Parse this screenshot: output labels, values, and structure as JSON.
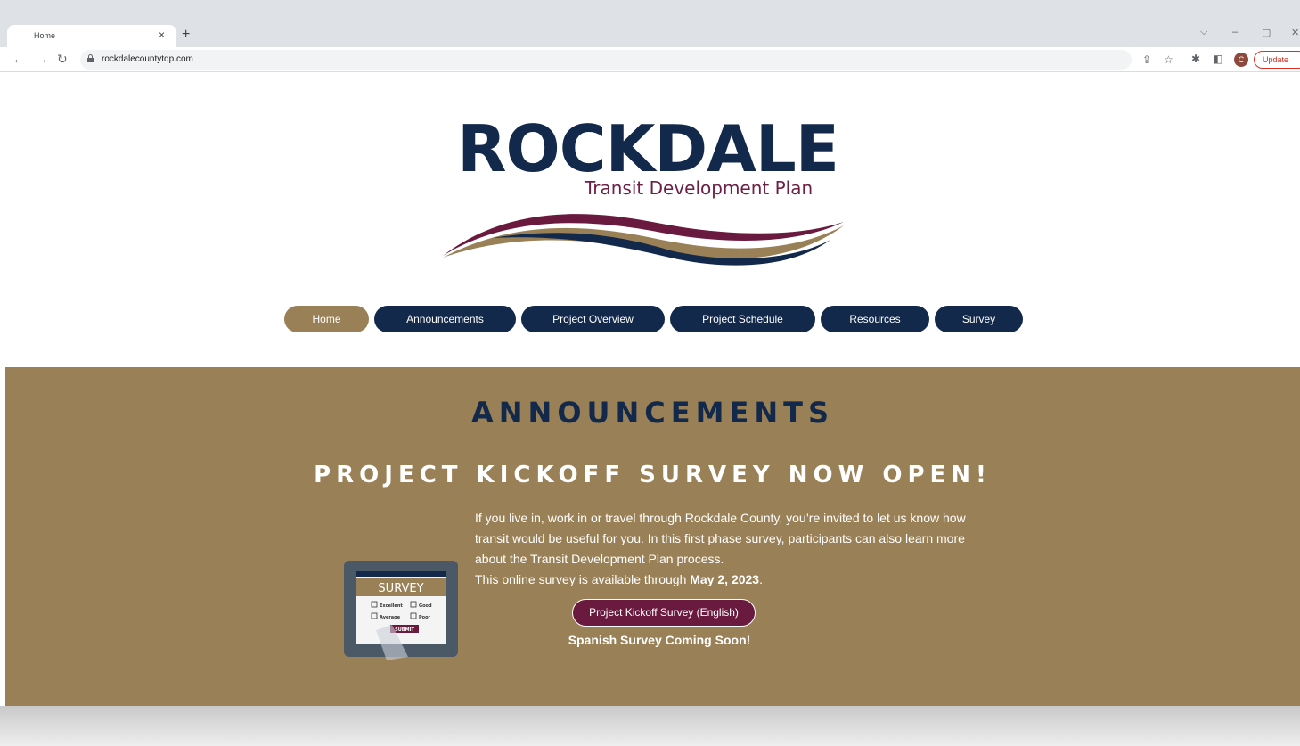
{
  "browser": {
    "tab_title": "Home",
    "tab_close": "×",
    "new_tab": "+",
    "url": "rockdalecountytdp.com",
    "profile_initial": "C",
    "update_label": "Update"
  },
  "logo": {
    "title": "ROCKDALE",
    "subtitle": "Transit Development Plan"
  },
  "nav": {
    "items": [
      "Home",
      "Announcements",
      "Project Overview",
      "Project Schedule",
      "Resources",
      "Survey"
    ],
    "active": "Home"
  },
  "announcements": {
    "title": "ANNOUNCEMENTS",
    "headline": "PROJECT KICKOFF SURVEY NOW OPEN!",
    "body_1": "If you live in, work in or travel through Rockdale County, you’re invited to let us know how transit would be useful for you. In this first phase survey, participants can also learn more about the Transit Development Plan process.",
    "body_2_prefix": "This online survey is available through ",
    "body_2_date": "May 2, 2023",
    "body_2_suffix": ".",
    "survey_button": "Project Kickoff Survey (English)",
    "spanish_note": "Spanish Survey Coming Soon!",
    "image": {
      "label": "SURVEY",
      "options": [
        "Excellent",
        "Good",
        "Average",
        "Poor"
      ],
      "submit": "SUBMIT"
    }
  },
  "colors": {
    "navy": "#13294b",
    "gold": "#9a8057",
    "maroon": "#6b1a3f"
  }
}
